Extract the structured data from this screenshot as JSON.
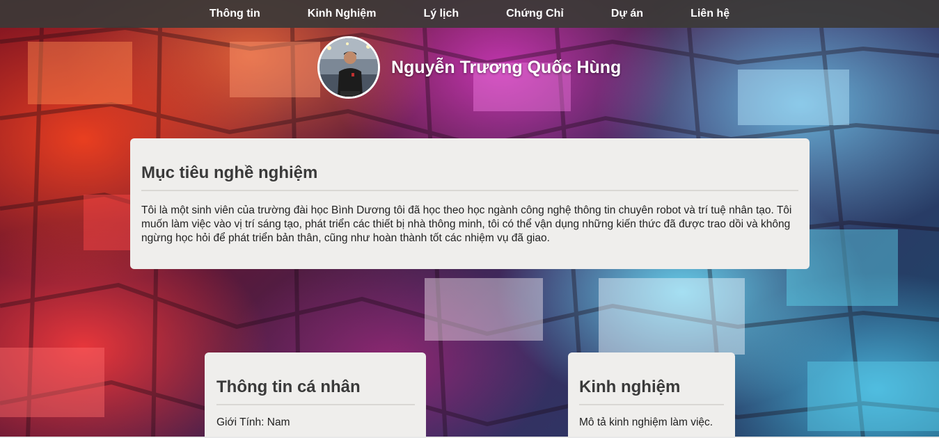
{
  "nav": {
    "items": [
      {
        "label": "Thông tin"
      },
      {
        "label": "Kinh Nghiệm"
      },
      {
        "label": "Lý lịch"
      },
      {
        "label": "Chứng Chỉ"
      },
      {
        "label": "Dự án"
      },
      {
        "label": "Liên hệ"
      }
    ]
  },
  "header": {
    "name": "Nguyễn Trương Quốc Hùng"
  },
  "objective": {
    "title": "Mục tiêu nghề nghiệm",
    "text": "Tôi là một sinh viên của trường đài học Bình Dương tôi đã học theo học ngành công nghệ thông tin chuyên robot và trí tuệ nhân tạo. Tôi muốn làm việc vào vị trí sáng tạo, phát triển các thiết bị nhà thông minh, tôi có thể vận dụng những kiến thức đã được trao dồi và không ngừng học hỏi để phát triển bản thân, cũng như hoàn thành tốt các nhiệm vụ đã giao."
  },
  "personal": {
    "title": "Thông tin cá nhân",
    "gender_line": "Giới Tính: Nam"
  },
  "experience": {
    "title": "Kinh nghiệm",
    "text": "Mô tả kinh nghiệm làm việc."
  },
  "colors": {
    "navbar_bg": "#3c3a37",
    "card_bg": "#efeeec",
    "heading": "#3a3a3a",
    "body_text": "#222222"
  }
}
